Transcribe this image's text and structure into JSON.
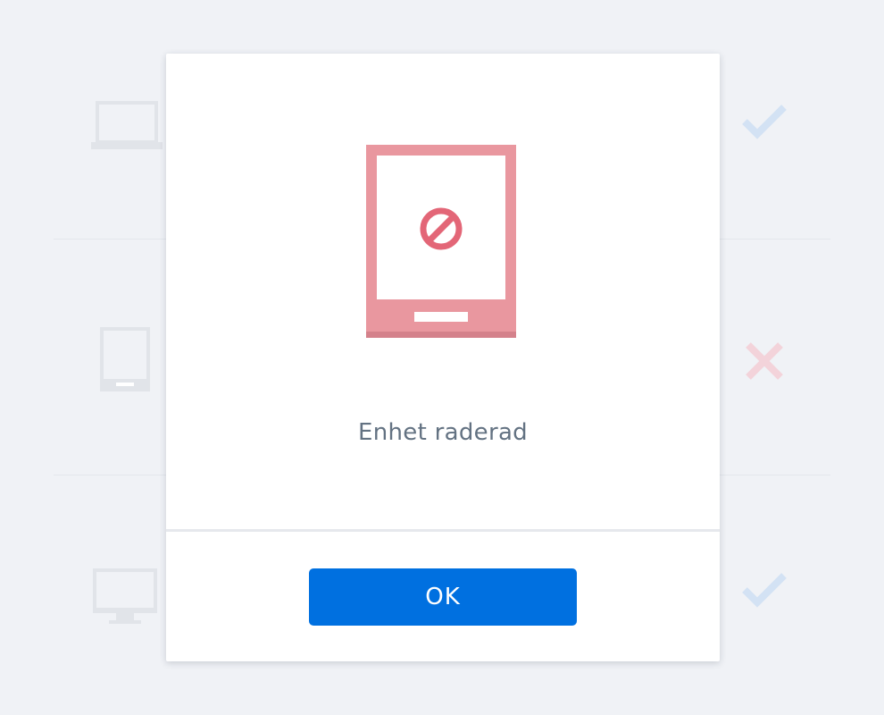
{
  "background": {
    "rows": [
      {
        "device_icon": "laptop-icon",
        "status_icon": "checkmark-icon",
        "status_color": "#d3e2f4"
      },
      {
        "device_icon": "tablet-icon",
        "status_icon": "x-mark-icon",
        "status_color": "#f3d3da"
      },
      {
        "device_icon": "desktop-icon",
        "status_icon": "checkmark-icon",
        "status_color": "#d3e2f4"
      }
    ],
    "device_icon_color": "#e1e4e9"
  },
  "modal": {
    "illustration": {
      "icon": "tablet-blocked-icon",
      "tablet_color": "#e9979f",
      "block_color": "#e36677"
    },
    "message": "Enhet raderad",
    "ok_button": {
      "label": "OK",
      "color": "#0070e0"
    }
  }
}
